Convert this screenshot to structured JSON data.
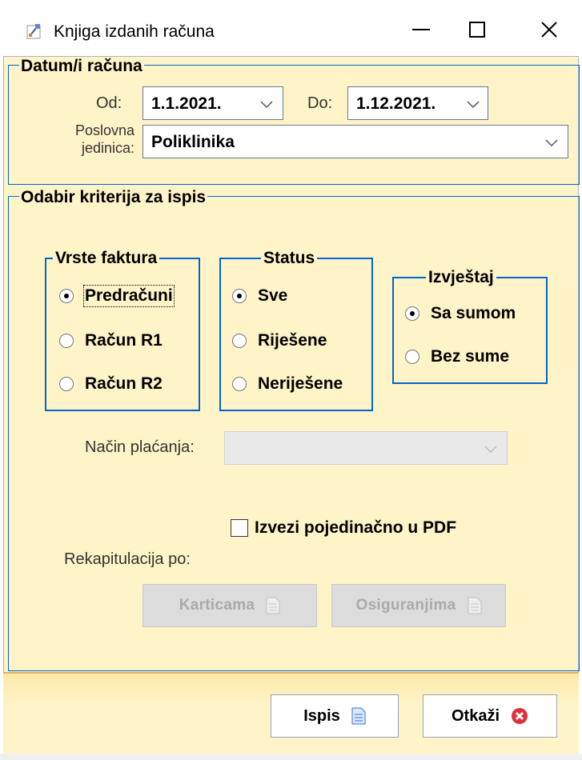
{
  "window": {
    "title": "Knjiga izdanih računa"
  },
  "datum": {
    "title": "Datum/i računa",
    "od_label": "Od:",
    "od_value": "1.1.2021.",
    "do_label": "Do:",
    "do_value": "1.12.2021.",
    "jedinica_label_1": "Poslovna",
    "jedinica_label_2": "jedinica:",
    "jedinica_value": "Poliklinika"
  },
  "kriteriji": {
    "title": "Odabir kriterija za ispis",
    "vrste": {
      "title": "Vrste faktura",
      "options": [
        "Predračuni",
        "Račun R1",
        "Račun R2"
      ],
      "selected": 0
    },
    "status": {
      "title": "Status",
      "options": [
        "Sve",
        "Riješene",
        "Neriješene"
      ],
      "selected": 0
    },
    "izvjestaj": {
      "title": "Izvještaj",
      "options": [
        "Sa sumom",
        "Bez sume"
      ],
      "selected": 0
    },
    "nacin_label": "Način plaćanja:",
    "nacin_value": "",
    "pdf_label": "Izvezi pojedinačno u PDF",
    "pdf_checked": false,
    "rekap_label": "Rekapitulacija po:",
    "karticama": "Karticama",
    "osiguranjima": "Osiguranjima"
  },
  "footer": {
    "ispis": "Ispis",
    "otkazi": "Otkaži"
  },
  "colors": {
    "panel": "#fff3c8",
    "border": "#0066cc",
    "cancel_red": "#e0303a"
  }
}
